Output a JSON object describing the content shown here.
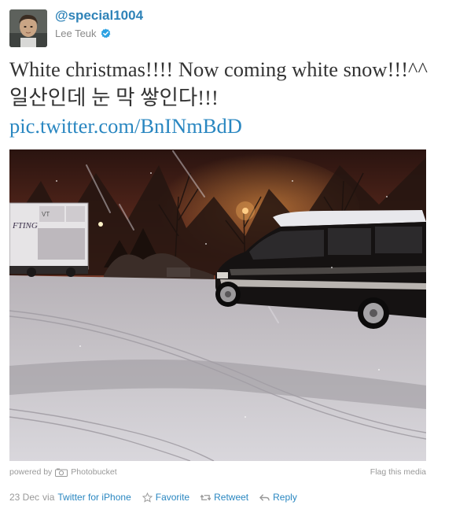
{
  "user": {
    "handle": "@special1004",
    "display_name": "Lee Teuk",
    "verified": true
  },
  "tweet": {
    "text": "White christmas!!!! Now coming white snow!!!^^일산인데 눈 막 쌓인다!!!",
    "link": "pic.twitter.com/BnINmBdD"
  },
  "media": {
    "powered_by_label": "powered by",
    "provider": "Photobucket",
    "flag_label": "Flag this media",
    "truck_text_1": "FTING",
    "truck_text_2": "VT"
  },
  "footer": {
    "date": "23 Dec",
    "via_label": "via",
    "source": "Twitter for iPhone",
    "favorite_label": "Favorite",
    "retweet_label": "Retweet",
    "reply_label": "Reply"
  },
  "colors": {
    "link": "#2a87c1",
    "handle": "#2f83b8",
    "muted": "#999999",
    "text": "#333333"
  }
}
